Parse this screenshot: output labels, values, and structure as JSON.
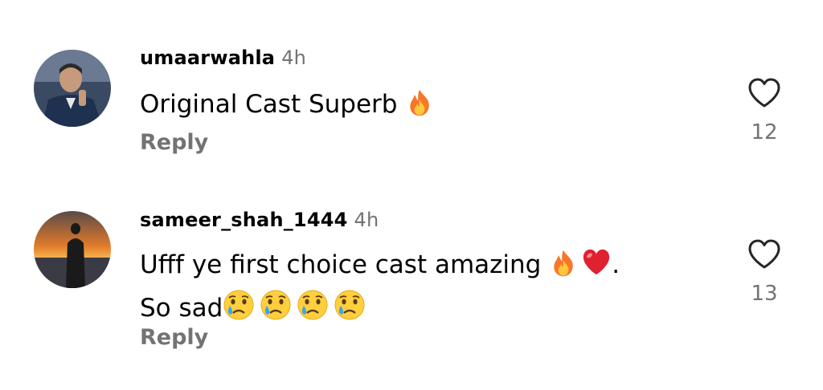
{
  "comments": [
    {
      "username": "umaarwahla",
      "time": "4h",
      "text_line1": "Original Cast Superb",
      "emoji_line1": [
        "fire-emoji"
      ],
      "reply_label": "Reply",
      "likes": "12"
    },
    {
      "username": "sameer_shah_1444",
      "time": "4h",
      "text_line1": "Ufff ye first choice cast amazing",
      "emoji_line1": [
        "fire-emoji",
        "red-heart-emoji"
      ],
      "text_line1_end": ".",
      "text_line2": "So sad",
      "emoji_line2": [
        "crying-face-emoji",
        "crying-face-emoji",
        "crying-face-emoji",
        "crying-face-emoji"
      ],
      "reply_label": "Reply",
      "likes": "13"
    }
  ],
  "icons": {
    "like": "heart-outline-icon"
  },
  "colors": {
    "secondary_text": "#737373",
    "background": "#ffffff"
  }
}
